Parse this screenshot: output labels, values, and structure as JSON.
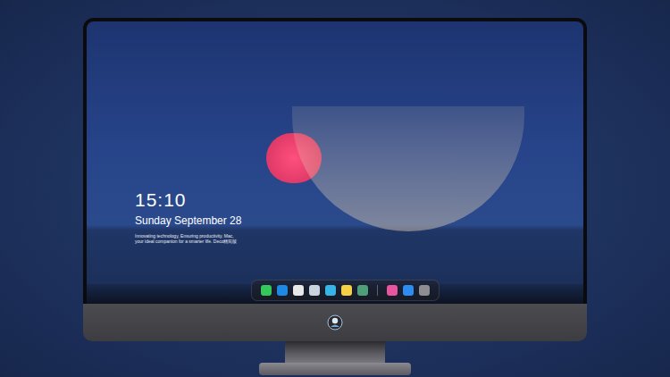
{
  "lock_screen": {
    "time": "15:10",
    "date": "Sunday September 28",
    "tagline": [
      "Innovating technology, Ensuring productivity. Mac,",
      "your ideal companion for a smarter life. Deco精简版"
    ]
  },
  "dock": {
    "pinned": [
      {
        "color": "#34c759"
      },
      {
        "color": "#1e88e5"
      },
      {
        "color": "#e8e8e8"
      },
      {
        "color": "#c9d3de"
      },
      {
        "color": "#37b5e6"
      },
      {
        "color": "#f5cf45"
      },
      {
        "color": "#4f9e7a"
      }
    ],
    "recent": [
      {
        "color": "#e8559f"
      },
      {
        "color": "#2e8cf0"
      },
      {
        "color": "#8d8d92"
      }
    ]
  }
}
